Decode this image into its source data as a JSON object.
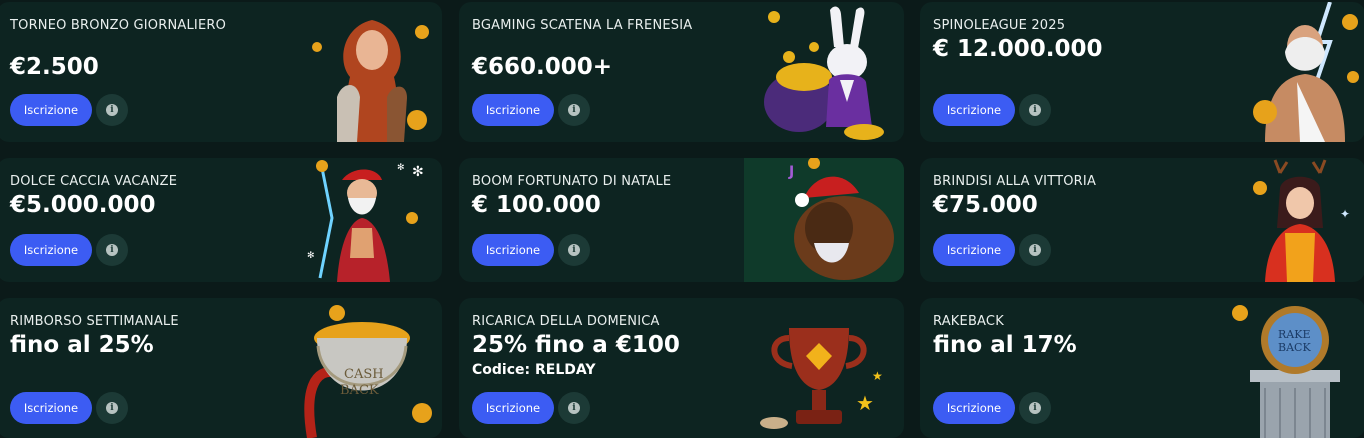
{
  "common": {
    "signup_label": "Iscrizione",
    "info_glyph": "i"
  },
  "cards": [
    {
      "title": "Torneo Bronzo Giornaliero",
      "amount": "€2.500",
      "image_icon": "warrior-woman-coins-icon"
    },
    {
      "title": "BGaming scatena la frenesia",
      "amount": "€660.000+",
      "image_icon": "rabbit-coins-icon"
    },
    {
      "title": "SpinoLeague 2025",
      "amount": "€ 12.000.000",
      "image_icon": "zeus-lightning-icon"
    },
    {
      "title": "Dolce Caccia Vacanze",
      "amount": "€5.000.000",
      "image_icon": "santa-warrior-icon"
    },
    {
      "title": "Boom Fortunato di Natale",
      "amount": "€ 100.000",
      "image_icon": "bison-santa-hat-icon"
    },
    {
      "title": "Brindisi alla Vittoria",
      "amount": "€75.000",
      "image_icon": "reindeer-girl-icon"
    },
    {
      "title": "Rimborso settimanale",
      "amount": "fino al 25%",
      "image_icon": "cashback-pot-icon"
    },
    {
      "title": "Ricarica della domenica",
      "amount": "25% fino a €100",
      "code": "Codice: RELDAY",
      "image_icon": "trophy-cup-icon"
    },
    {
      "title": "Rakeback",
      "amount": "fino al 17%",
      "image_icon": "rakeback-pillar-icon"
    }
  ],
  "colors": {
    "page_bg": "#0b1a19",
    "card_bg": "#0d2421",
    "button": "#3c5cf3",
    "info_button": "#1c3a36"
  }
}
